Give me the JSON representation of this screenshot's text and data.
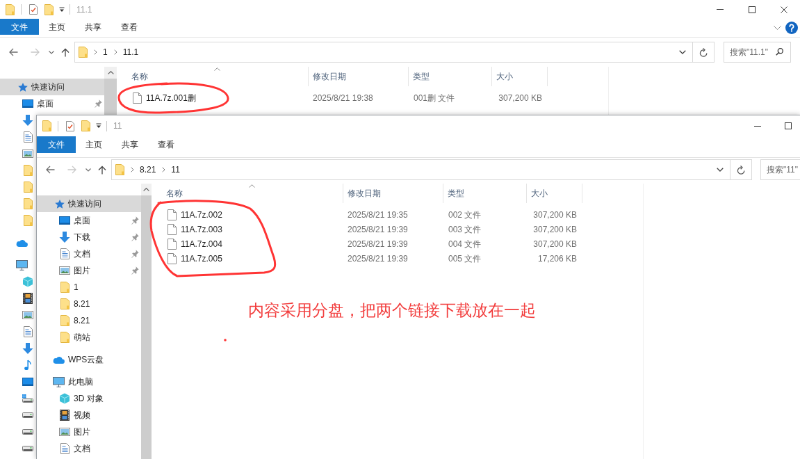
{
  "back_window": {
    "title": "11.1",
    "ribbon_tabs": [
      {
        "label": "文件",
        "kind": "file"
      },
      {
        "label": "主页",
        "kind": "tab"
      },
      {
        "label": "共享",
        "kind": "tab"
      },
      {
        "label": "查看",
        "kind": "tab"
      }
    ],
    "navigation": [
      {
        "kind": "back",
        "disabled": false
      },
      {
        "kind": "forward",
        "disabled": true
      },
      {
        "kind": "recent",
        "disabled": false
      },
      {
        "kind": "up",
        "disabled": false
      }
    ],
    "address": {
      "path": [
        "1",
        "11.1"
      ]
    },
    "search": {
      "placeholder": "搜索\"11.1\""
    },
    "sidebar": [
      {
        "label": "快速访问",
        "kind": "quick",
        "selected": true,
        "children": [
          {
            "label": "桌面",
            "kind": "desktop",
            "pinned": true,
            "selected": false
          },
          {
            "kind": "downloads",
            "selected": false
          },
          {
            "kind": "documents",
            "selected": false
          },
          {
            "kind": "pictures",
            "selected": false
          },
          {
            "kind": "folder",
            "selected": false
          },
          {
            "kind": "folder",
            "selected": false
          },
          {
            "kind": "folder",
            "selected": false
          },
          {
            "kind": "folder",
            "selected": false
          }
        ]
      },
      {
        "kind": "cloud",
        "selected": false
      },
      {
        "kind": "computer",
        "selected": false,
        "children": [
          {
            "kind": "objects",
            "selected": false
          },
          {
            "kind": "videos",
            "selected": false
          },
          {
            "kind": "pictures",
            "selected": false
          },
          {
            "kind": "documents",
            "selected": false
          },
          {
            "kind": "downloads",
            "selected": false
          },
          {
            "kind": "music",
            "selected": false
          },
          {
            "kind": "desktop",
            "selected": false
          },
          {
            "kind": "system",
            "selected": false
          },
          {
            "kind": "drive",
            "selected": false
          },
          {
            "kind": "drive",
            "selected": false
          },
          {
            "kind": "drive",
            "selected": false
          }
        ]
      }
    ],
    "columns": [
      {
        "label": "名称",
        "sorted": true
      },
      {
        "label": "修改日期",
        "sorted": false
      },
      {
        "label": "类型",
        "sorted": false
      },
      {
        "label": "大小",
        "sorted": false
      }
    ],
    "files": [
      {
        "name": "11A.7z.001删",
        "modified": "2025/8/21 19:38",
        "type": "001删 文件",
        "size": "307,200 KB"
      }
    ]
  },
  "front_window": {
    "title": "11",
    "ribbon_tabs": [
      {
        "label": "文件",
        "kind": "file"
      },
      {
        "label": "主页",
        "kind": "tab"
      },
      {
        "label": "共享",
        "kind": "tab"
      },
      {
        "label": "查看",
        "kind": "tab"
      }
    ],
    "navigation": [
      {
        "kind": "back",
        "disabled": false
      },
      {
        "kind": "forward",
        "disabled": true
      },
      {
        "kind": "recent",
        "disabled": false
      },
      {
        "kind": "up",
        "disabled": false
      }
    ],
    "address": {
      "path": [
        "8.21",
        "11"
      ]
    },
    "search": {
      "placeholder": "搜索\"11\""
    },
    "sidebar": [
      {
        "label": "快速访问",
        "kind": "quick",
        "selected": true,
        "children": [
          {
            "label": "桌面",
            "kind": "desktop",
            "pinned": true,
            "selected": false
          },
          {
            "label": "下载",
            "kind": "downloads",
            "pinned": true,
            "selected": false
          },
          {
            "label": "文档",
            "kind": "documents",
            "pinned": true,
            "selected": false
          },
          {
            "label": "图片",
            "kind": "pictures",
            "pinned": true,
            "selected": false
          },
          {
            "label": "1",
            "kind": "folder",
            "pinned": false,
            "selected": false
          },
          {
            "label": "8.21",
            "kind": "folder",
            "pinned": false,
            "selected": false
          },
          {
            "label": "8.21",
            "kind": "folder",
            "pinned": false,
            "selected": false
          },
          {
            "label": "萌站",
            "kind": "folder",
            "pinned": false,
            "selected": false
          }
        ]
      },
      {
        "label": "WPS云盘",
        "kind": "cloud",
        "selected": false
      },
      {
        "label": "此电脑",
        "kind": "computer",
        "selected": false,
        "children": [
          {
            "label": "3D 对象",
            "kind": "objects",
            "selected": false
          },
          {
            "label": "视频",
            "kind": "videos",
            "selected": false
          },
          {
            "label": "图片",
            "kind": "pictures",
            "selected": false
          },
          {
            "label": "文档",
            "kind": "documents",
            "selected": false
          }
        ]
      }
    ],
    "columns": [
      {
        "label": "名称",
        "sorted": true
      },
      {
        "label": "修改日期",
        "sorted": false
      },
      {
        "label": "类型",
        "sorted": false
      },
      {
        "label": "大小",
        "sorted": false
      }
    ],
    "files": [
      {
        "name": "11A.7z.002",
        "modified": "2025/8/21 19:35",
        "type": "002 文件",
        "size": "307,200 KB"
      },
      {
        "name": "11A.7z.003",
        "modified": "2025/8/21 19:39",
        "type": "003 文件",
        "size": "307,200 KB"
      },
      {
        "name": "11A.7z.004",
        "modified": "2025/8/21 19:39",
        "type": "004 文件",
        "size": "307,200 KB"
      },
      {
        "name": "11A.7z.005",
        "modified": "2025/8/21 19:39",
        "type": "005 文件",
        "size": "17,206 KB"
      }
    ]
  },
  "annotation": {
    "text": "内容采用分盘，把两个链接下载放在一起"
  }
}
